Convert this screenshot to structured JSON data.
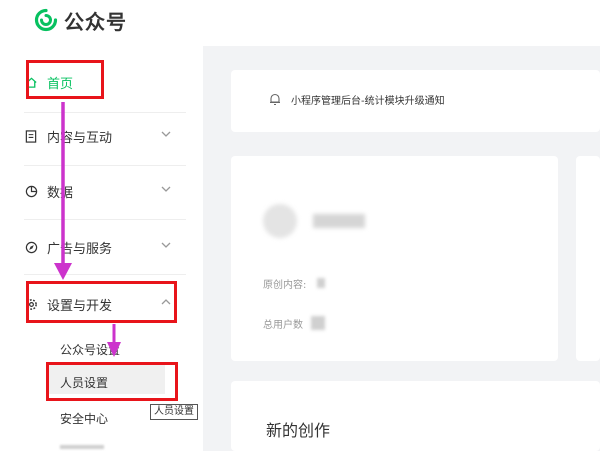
{
  "app": {
    "brand": "公众号",
    "brand_color": "#07c160"
  },
  "sidebar": {
    "home": {
      "label": "首页",
      "icon": "home-icon",
      "color": "#07c160"
    },
    "content": {
      "label": "内容与互动",
      "icon": "document-icon"
    },
    "data": {
      "label": "数据",
      "icon": "pie-chart-icon"
    },
    "ads": {
      "label": "广告与服务",
      "icon": "compass-icon"
    },
    "settings": {
      "label": "设置与开发",
      "icon": "gear-icon",
      "expanded": true,
      "sub_items": [
        {
          "label": "公众号设置"
        },
        {
          "label": "人员设置"
        },
        {
          "label": "安全中心"
        }
      ]
    }
  },
  "tooltip": {
    "text": "人员设置"
  },
  "main": {
    "notice": {
      "text": "小程序管理后台-统计模块升级通知"
    },
    "profile": {
      "original_label": "原创内容:",
      "users_label": "总用户数"
    },
    "creation": {
      "title": "新的创作"
    }
  },
  "annotation": {
    "highlight_color": "#e8141a",
    "arrow_color": "#cc33cc"
  }
}
